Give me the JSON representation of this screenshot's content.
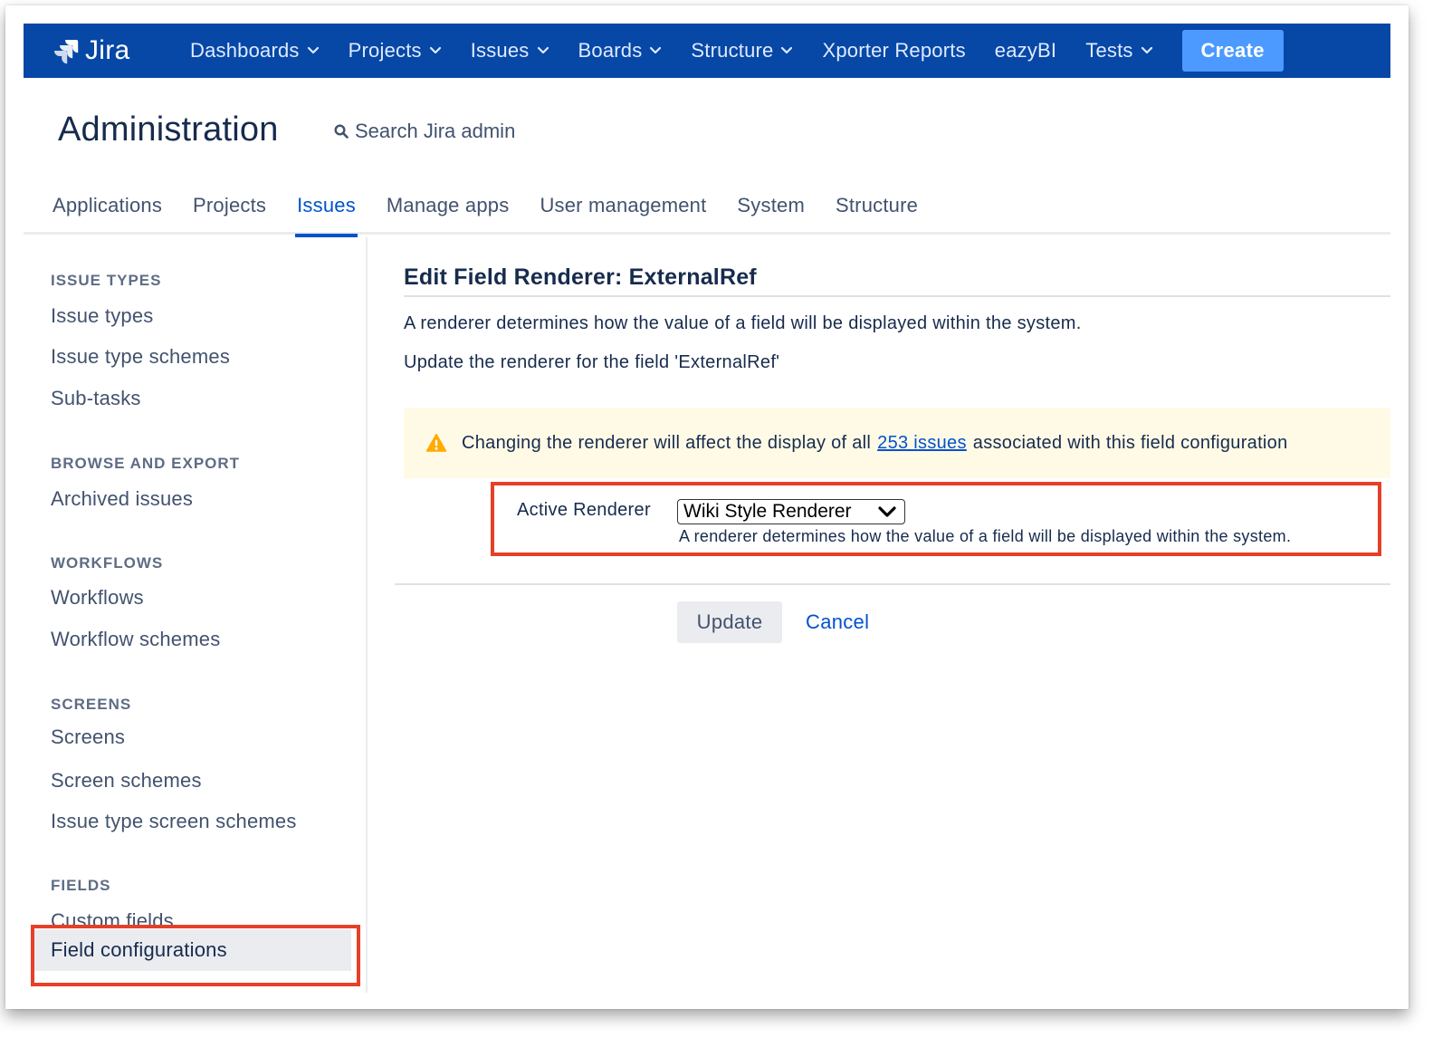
{
  "topbar": {
    "logo_text": "Jira",
    "nav": [
      {
        "label": "Dashboards",
        "dropdown": true
      },
      {
        "label": "Projects",
        "dropdown": true
      },
      {
        "label": "Issues",
        "dropdown": true
      },
      {
        "label": "Boards",
        "dropdown": true
      },
      {
        "label": "Structure",
        "dropdown": true
      },
      {
        "label": "Xporter Reports",
        "dropdown": false
      },
      {
        "label": "eazyBI",
        "dropdown": false
      },
      {
        "label": "Tests",
        "dropdown": true
      }
    ],
    "create_label": "Create",
    "colors": {
      "bar": "#0747a6",
      "create": "#4c9aff"
    }
  },
  "header": {
    "title": "Administration",
    "search_label": "Search Jira admin"
  },
  "tabs": [
    {
      "label": "Applications",
      "active": false
    },
    {
      "label": "Projects",
      "active": false
    },
    {
      "label": "Issues",
      "active": true
    },
    {
      "label": "Manage apps",
      "active": false
    },
    {
      "label": "User management",
      "active": false
    },
    {
      "label": "System",
      "active": false
    },
    {
      "label": "Structure",
      "active": false
    }
  ],
  "sidebar": {
    "sections": [
      {
        "heading": "ISSUE TYPES",
        "items": [
          "Issue types",
          "Issue type schemes",
          "Sub-tasks"
        ]
      },
      {
        "heading": "BROWSE AND EXPORT",
        "items": [
          "Archived issues"
        ]
      },
      {
        "heading": "WORKFLOWS",
        "items": [
          "Workflows",
          "Workflow schemes"
        ]
      },
      {
        "heading": "SCREENS",
        "items": [
          "Screens",
          "Screen schemes",
          "Issue type screen schemes"
        ]
      },
      {
        "heading": "FIELDS",
        "items": [
          "Custom fields",
          "Field configurations"
        ]
      }
    ],
    "selected_item": "Field configurations"
  },
  "content": {
    "heading": "Edit Field Renderer: ExternalRef",
    "description": "A renderer determines how the value of a field will be displayed within the system.",
    "update_text": "Update the renderer for the field 'ExternalRef'",
    "warning": {
      "before": "Changing the renderer will affect the display of all",
      "link": "253 issues",
      "after": "associated with this field configuration"
    },
    "form": {
      "label": "Active Renderer",
      "selected": "Wiki Style Renderer",
      "field_description": "A renderer determines how the value of a field will be displayed within the system."
    },
    "buttons": {
      "update": "Update",
      "cancel": "Cancel"
    }
  },
  "colors": {
    "link": "#0052cc",
    "warning_bg": "#fffae6",
    "warning_icon": "#ffab00",
    "highlight": "#e64028"
  }
}
